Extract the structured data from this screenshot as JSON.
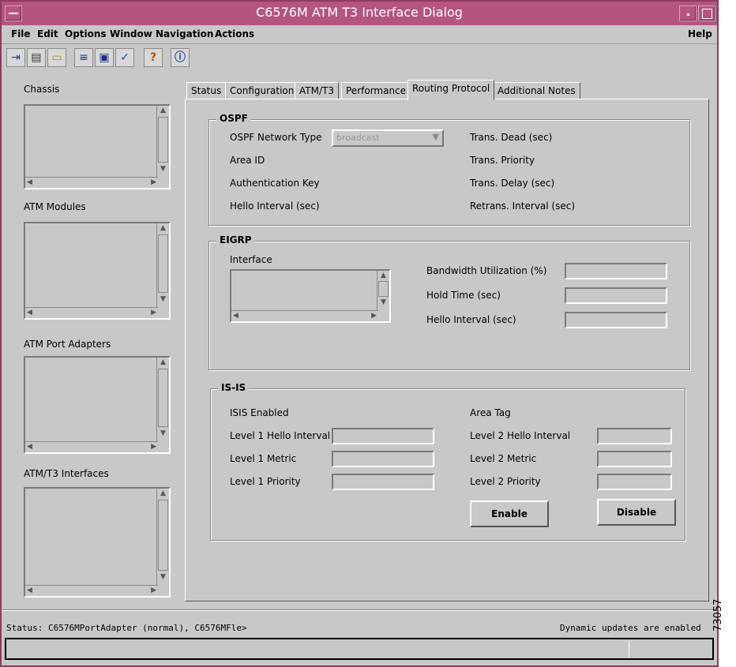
{
  "window": {
    "title": "C6576M ATM T3 Interface Dialog"
  },
  "menu": {
    "file": "File",
    "edit": "Edit",
    "options": "Options",
    "window": "Window",
    "navigation": "Navigation",
    "actions": "Actions",
    "help": "Help"
  },
  "toolbar": {
    "icons": [
      "exit-icon",
      "print-icon",
      "open-folder-icon",
      "list-icon",
      "monitor-icon",
      "checkmark-icon",
      "help-icon",
      "info-icon"
    ]
  },
  "sidebar": {
    "chassis": "Chassis",
    "atm_modules": "ATM Modules",
    "atm_port_adapters": "ATM Port Adapters",
    "atm_t3_interfaces": "ATM/T3 Interfaces"
  },
  "tabs": [
    "Status",
    "Configuration",
    "ATM/T3",
    "Performance",
    "Routing Protocol",
    "Additional Notes"
  ],
  "active_tab": "Routing Protocol",
  "ospf": {
    "title": "OSPF",
    "network_type_label": "OSPF Network Type",
    "network_type_value": "broadcast",
    "area_id": "Area ID",
    "auth_key": "Authentication Key",
    "hello_interval": "Hello Interval (sec)",
    "trans_dead": "Trans. Dead (sec)",
    "trans_priority": "Trans. Priority",
    "trans_delay": "Trans. Delay (sec)",
    "retrans_interval": "Retrans. Interval (sec)"
  },
  "eigrp": {
    "title": "EIGRP",
    "interface": "Interface",
    "bandwidth": "Bandwidth Utilization (%)",
    "hold_time": "Hold Time (sec)",
    "hello_interval": "Hello Interval (sec)"
  },
  "isis": {
    "title": "IS-IS",
    "enabled": "ISIS Enabled",
    "area_tag": "Area Tag",
    "l1_hello": "Level 1 Hello Interval",
    "l1_metric": "Level 1 Metric",
    "l1_priority": "Level 1 Priority",
    "l2_hello": "Level 2 Hello Interval",
    "l2_metric": "Level 2 Metric",
    "l2_priority": "Level 2 Priority",
    "enable_button": "Enable",
    "disable_button": "Disable"
  },
  "status": {
    "left": "Status: C6576MPortAdapter (normal), C6576MFle>",
    "right": "Dynamic updates are enabled"
  },
  "figure_id": "73057"
}
